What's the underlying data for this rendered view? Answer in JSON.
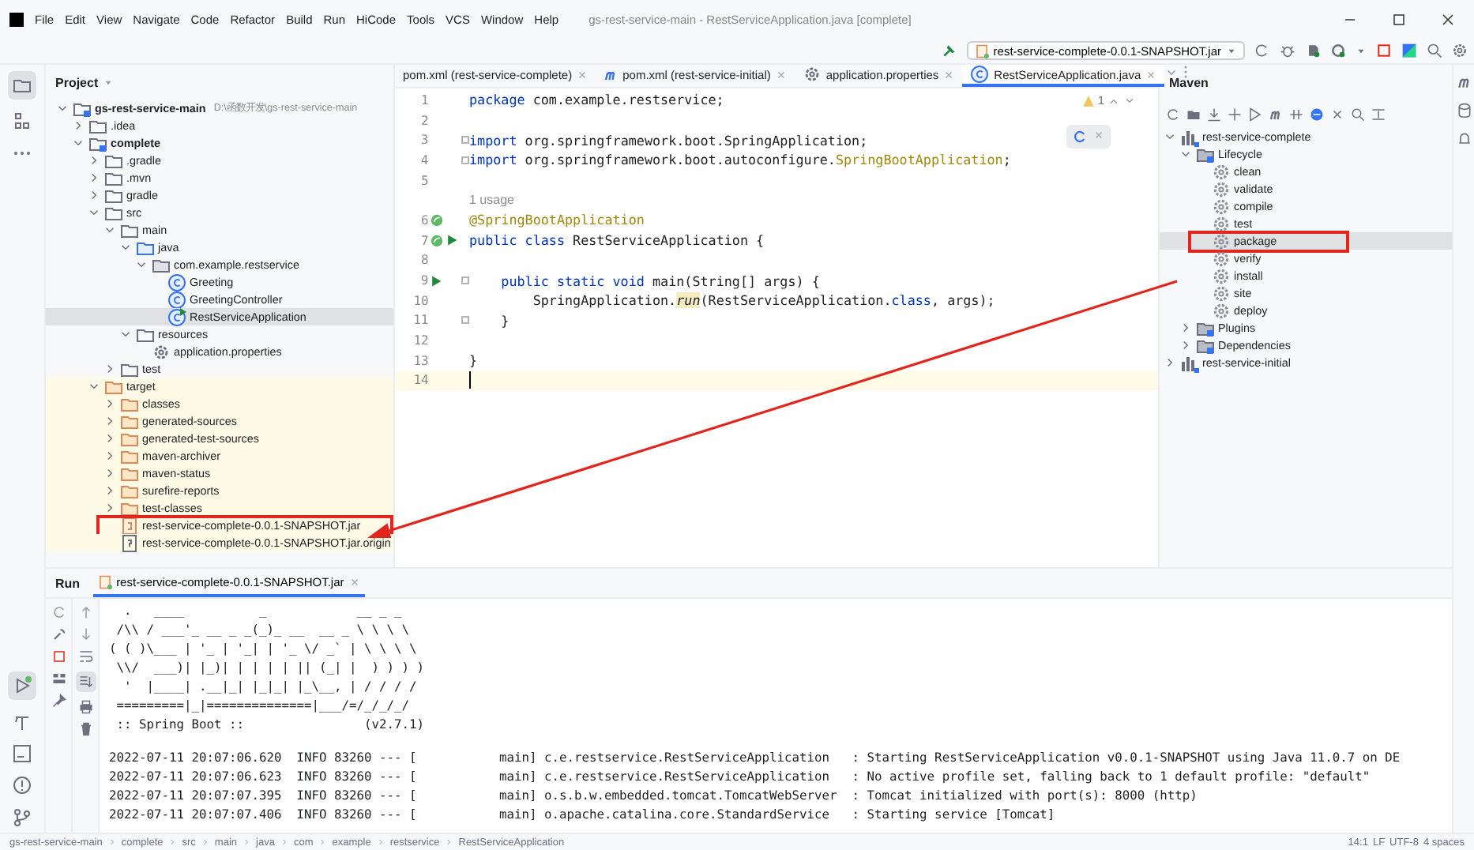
{
  "menu_bar": {
    "items": [
      "File",
      "Edit",
      "View",
      "Navigate",
      "Code",
      "Refactor",
      "Build",
      "Run",
      "HiCode",
      "Tools",
      "VCS",
      "Window",
      "Help"
    ],
    "window_title": "gs-rest-service-main - RestServiceApplication.java [complete]"
  },
  "toolbar": {
    "run_config": "rest-service-complete-0.0.1-SNAPSHOT.jar"
  },
  "project_panel": {
    "title": "Project",
    "tree": [
      {
        "label": "gs-rest-service-main",
        "path": "D:\\函数开发\\gs-rest-service-main",
        "kind": "module",
        "expanded": true,
        "selected": false,
        "children": [
          {
            "label": ".idea",
            "kind": "folder",
            "expanded": false,
            "selected": false
          },
          {
            "label": "complete",
            "kind": "module",
            "expanded": true,
            "selected": false,
            "children": [
              {
                "label": ".gradle",
                "kind": "folder",
                "expanded": false,
                "selected": false
              },
              {
                "label": ".mvn",
                "kind": "folder",
                "expanded": false,
                "selected": false
              },
              {
                "label": "gradle",
                "kind": "folder",
                "expanded": false,
                "selected": false
              },
              {
                "label": "src",
                "kind": "folder",
                "expanded": true,
                "selected": false,
                "children": [
                  {
                    "label": "main",
                    "kind": "folder",
                    "expanded": true,
                    "selected": false,
                    "children": [
                      {
                        "label": "java",
                        "kind": "source-folder",
                        "expanded": true,
                        "selected": false,
                        "children": [
                          {
                            "label": "com.example.restservice",
                            "kind": "package",
                            "expanded": true,
                            "selected": false,
                            "children": [
                              {
                                "label": "Greeting",
                                "kind": "class",
                                "selected": false
                              },
                              {
                                "label": "GreetingController",
                                "kind": "class",
                                "selected": false
                              },
                              {
                                "label": "RestServiceApplication",
                                "kind": "app-class",
                                "selected": true
                              }
                            ]
                          }
                        ]
                      },
                      {
                        "label": "resources",
                        "kind": "folder",
                        "expanded": true,
                        "selected": false,
                        "children": [
                          {
                            "label": "application.properties",
                            "kind": "properties",
                            "selected": false
                          }
                        ]
                      }
                    ]
                  },
                  {
                    "label": "test",
                    "kind": "folder",
                    "expanded": false,
                    "selected": false
                  }
                ]
              },
              {
                "label": "target",
                "kind": "folder",
                "excluded": true,
                "expanded": true,
                "selected": false,
                "children": [
                  {
                    "label": "classes",
                    "kind": "folder",
                    "expanded": false,
                    "selected": false
                  },
                  {
                    "label": "generated-sources",
                    "kind": "folder",
                    "expanded": false,
                    "selected": false
                  },
                  {
                    "label": "generated-test-sources",
                    "kind": "folder",
                    "expanded": false,
                    "selected": false
                  },
                  {
                    "label": "maven-archiver",
                    "kind": "folder",
                    "expanded": false,
                    "selected": false
                  },
                  {
                    "label": "maven-status",
                    "kind": "folder",
                    "expanded": false,
                    "selected": false
                  },
                  {
                    "label": "surefire-reports",
                    "kind": "folder",
                    "expanded": false,
                    "selected": false
                  },
                  {
                    "label": "test-classes",
                    "kind": "folder",
                    "expanded": false,
                    "selected": false
                  },
                  {
                    "label": "rest-service-complete-0.0.1-SNAPSHOT.jar",
                    "kind": "jar",
                    "selected": false,
                    "highlighted": true
                  },
                  {
                    "label": "rest-service-complete-0.0.1-SNAPSHOT.jar.origin",
                    "kind": "file",
                    "selected": false
                  }
                ]
              }
            ]
          }
        ]
      }
    ]
  },
  "editor": {
    "tabs": [
      {
        "label": "pom.xml (rest-service-complete)",
        "kind": "xml",
        "selected": false
      },
      {
        "label": "pom.xml (rest-service-initial)",
        "kind": "maven",
        "selected": false
      },
      {
        "label": "application.properties",
        "kind": "properties",
        "selected": false
      },
      {
        "label": "RestServiceApplication.java",
        "kind": "class",
        "selected": true
      }
    ],
    "warning_count": "1",
    "lines": [
      {
        "kind": "code",
        "number": "1",
        "tokens": [
          {
            "kind": "keyword",
            "text": "package"
          },
          {
            "kind": "plain",
            "text": " com.example.restservice;"
          }
        ]
      },
      {
        "kind": "code",
        "number": "2"
      },
      {
        "kind": "code",
        "number": "3",
        "fold": true,
        "tokens": [
          {
            "kind": "keyword",
            "text": "import"
          },
          {
            "kind": "plain",
            "text": " org.springframework.boot.SpringApplication;"
          }
        ]
      },
      {
        "kind": "code",
        "number": "4",
        "fold": true,
        "tokens": [
          {
            "kind": "keyword",
            "text": "import"
          },
          {
            "kind": "plain",
            "text": " org.springframework.boot.autoconfigure."
          },
          {
            "kind": "annotation",
            "text": "SpringBootApplication"
          },
          {
            "kind": "plain",
            "text": ";"
          }
        ]
      },
      {
        "kind": "code",
        "number": "5"
      },
      {
        "kind": "hint",
        "text": "1 usage"
      },
      {
        "kind": "code",
        "number": "6",
        "bean": true,
        "tokens": [
          {
            "kind": "annotation",
            "text": "@SpringBootApplication"
          }
        ]
      },
      {
        "kind": "code",
        "number": "7",
        "bean": true,
        "run": true,
        "tokens": [
          {
            "kind": "keyword",
            "text": "public class"
          },
          {
            "kind": "plain",
            "text": " RestServiceApplication {"
          }
        ]
      },
      {
        "kind": "code",
        "number": "8"
      },
      {
        "kind": "code",
        "number": "9",
        "run": true,
        "fold": true,
        "tokens": [
          {
            "kind": "keyword",
            "text": "    public static void"
          },
          {
            "kind": "plain",
            "text": " main(String[] args) {"
          }
        ]
      },
      {
        "kind": "code",
        "number": "10",
        "tokens": [
          {
            "kind": "plain",
            "text": "        SpringApplication."
          },
          {
            "kind": "static-call",
            "text": "run"
          },
          {
            "kind": "plain",
            "text": "(RestServiceApplication."
          },
          {
            "kind": "keyword",
            "text": "class"
          },
          {
            "kind": "plain",
            "text": ", args);"
          }
        ]
      },
      {
        "kind": "code",
        "number": "11",
        "fold": true,
        "tokens": [
          {
            "kind": "plain",
            "text": "    }"
          }
        ]
      },
      {
        "kind": "code",
        "number": "12"
      },
      {
        "kind": "code",
        "number": "13",
        "tokens": [
          {
            "kind": "plain",
            "text": "}"
          }
        ]
      },
      {
        "kind": "code",
        "number": "14",
        "current": true
      }
    ]
  },
  "maven_panel": {
    "title": "Maven",
    "tree": [
      {
        "label": "rest-service-complete",
        "kind": "maven-project",
        "expanded": true,
        "selected": false,
        "children": [
          {
            "label": "Lifecycle",
            "kind": "lifecycle",
            "expanded": true,
            "selected": false,
            "children": [
              {
                "label": "clean",
                "kind": "goal",
                "selected": false
              },
              {
                "label": "validate",
                "kind": "goal",
                "selected": false
              },
              {
                "label": "compile",
                "kind": "goal",
                "selected": false
              },
              {
                "label": "test",
                "kind": "goal",
                "selected": false
              },
              {
                "label": "package",
                "kind": "goal",
                "selected": true,
                "highlighted": true
              },
              {
                "label": "verify",
                "kind": "goal",
                "selected": false
              },
              {
                "label": "install",
                "kind": "goal",
                "selected": false
              },
              {
                "label": "site",
                "kind": "goal",
                "selected": false
              },
              {
                "label": "deploy",
                "kind": "goal",
                "selected": false
              }
            ]
          },
          {
            "label": "Plugins",
            "kind": "lifecycle",
            "expanded": false,
            "selected": false
          },
          {
            "label": "Dependencies",
            "kind": "lifecycle",
            "expanded": false,
            "selected": false
          }
        ]
      },
      {
        "label": "rest-service-initial",
        "kind": "maven-project",
        "expanded": false,
        "selected": false
      }
    ]
  },
  "run_panel": {
    "title": "Run",
    "tabs": [
      {
        "label": "rest-service-complete-0.0.1-SNAPSHOT.jar",
        "selected": true
      }
    ],
    "banner": [
      "  .   ____          _            __ _ _",
      " /\\\\ / ___'_ __ _ _(_)_ __  __ _ \\ \\ \\ \\",
      "( ( )\\___ | '_ | '_| | '_ \\/ _` | \\ \\ \\ \\",
      " \\\\/  ___)| |_)| | | | | || (_| |  ) ) ) )",
      "  '  |____| .__|_| |_|_| |_\\__, | / / / /",
      " =========|_|==============|___/=/_/_/_/",
      " :: Spring Boot ::                (v2.7.1)"
    ],
    "log": [
      "2022-07-11 20:07:06.620  INFO 83260 --- [           main] c.e.restservice.RestServiceApplication   : Starting RestServiceApplication v0.0.1-SNAPSHOT using Java 11.0.7 on DE",
      "2022-07-11 20:07:06.623  INFO 83260 --- [           main] c.e.restservice.RestServiceApplication   : No active profile set, falling back to 1 default profile: \"default\"",
      "2022-07-11 20:07:07.395  INFO 83260 --- [           main] o.s.b.w.embedded.tomcat.TomcatWebServer  : Tomcat initialized with port(s): 8000 (http)",
      "2022-07-11 20:07:07.406  INFO 83260 --- [           main] o.apache.catalina.core.StandardService   : Starting service [Tomcat]"
    ]
  },
  "status_bar": {
    "breadcrumbs": [
      "gs-rest-service-main",
      "complete",
      "src",
      "main",
      "java",
      "com",
      "example",
      "restservice",
      "RestServiceApplication"
    ],
    "items": [
      "14:1",
      "LF",
      "UTF-8",
      "4 spaces"
    ]
  }
}
